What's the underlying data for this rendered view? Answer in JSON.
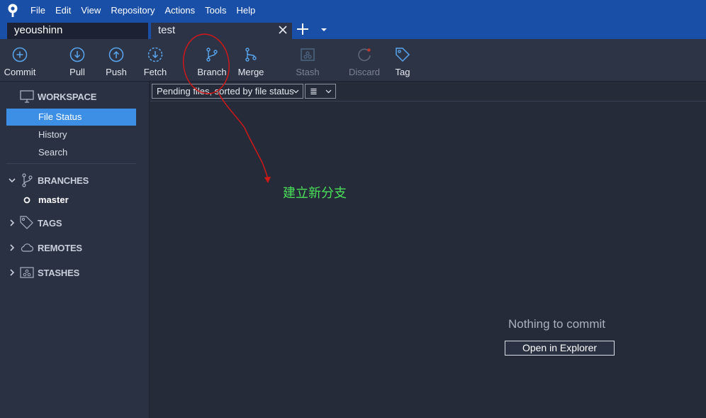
{
  "menu": [
    "File",
    "Edit",
    "View",
    "Repository",
    "Actions",
    "Tools",
    "Help"
  ],
  "tabs": [
    {
      "label": "yeoushinn"
    },
    {
      "label": "test"
    }
  ],
  "toolbar": {
    "commit": "Commit",
    "pull": "Pull",
    "push": "Push",
    "fetch": "Fetch",
    "branch": "Branch",
    "merge": "Merge",
    "stash": "Stash",
    "discard": "Discard",
    "tag": "Tag"
  },
  "sidebar": {
    "workspace": {
      "title": "WORKSPACE",
      "items": [
        "File Status",
        "History",
        "Search"
      ],
      "selected": "File Status"
    },
    "branches": {
      "title": "BRANCHES",
      "items": [
        "master"
      ]
    },
    "tags": {
      "title": "TAGS"
    },
    "remotes": {
      "title": "REMOTES"
    },
    "stashes": {
      "title": "STASHES"
    }
  },
  "main": {
    "filter": "Pending files, sorted by file status",
    "view_mode": "≣",
    "empty_message": "Nothing to commit",
    "open_button": "Open in Explorer"
  },
  "annotation": {
    "text": "建立新分支",
    "color": "#4ae05a",
    "marker_color": "#d01818"
  },
  "colors": {
    "accent": "#3d8fe6",
    "titlebar": "#1a4fa8"
  }
}
